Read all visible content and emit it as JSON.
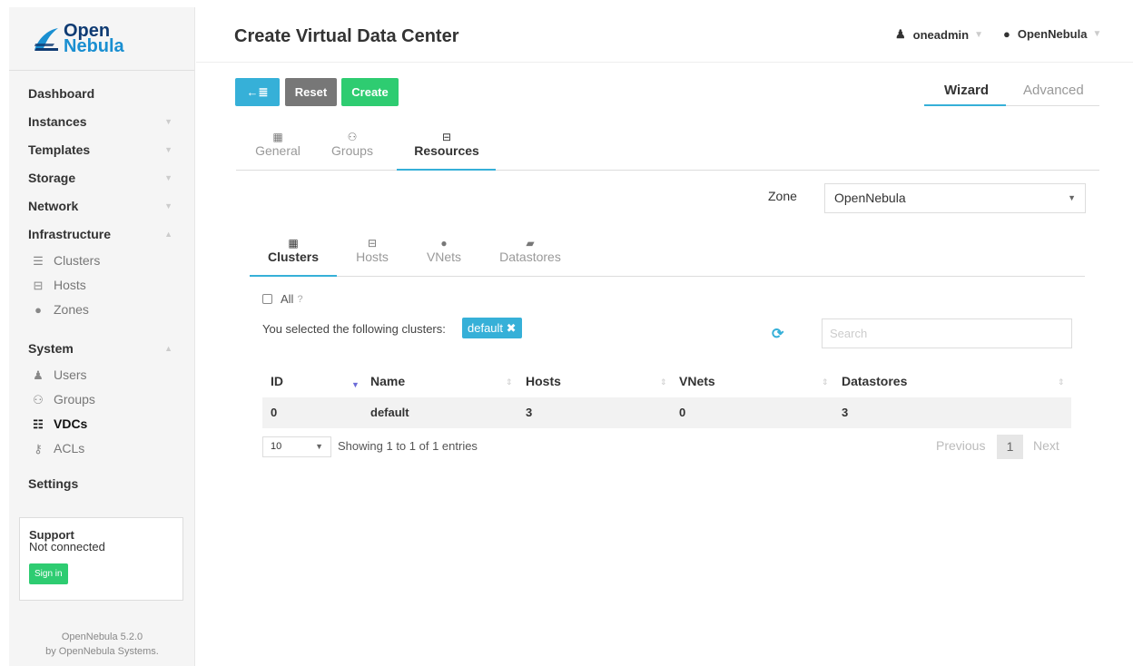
{
  "sidebar": {
    "logo": {
      "line1": "Open",
      "line2": "Nebula"
    },
    "menu": {
      "dashboard": "Dashboard",
      "instances": "Instances",
      "templates": "Templates",
      "storage": "Storage",
      "network": "Network",
      "infrastructure": "Infrastructure",
      "clusters": "Clusters",
      "hosts": "Hosts",
      "zones": "Zones",
      "system": "System",
      "users": "Users",
      "groups": "Groups",
      "vdcs": "VDCs",
      "acls": "ACLs",
      "settings": "Settings"
    },
    "support": {
      "title": "Support",
      "status": "Not connected",
      "signin": "Sign in"
    },
    "version": {
      "line1": "OpenNebula 5.2.0",
      "line2": "by OpenNebula Systems."
    }
  },
  "header": {
    "title": "Create Virtual Data Center",
    "user": "oneadmin",
    "zone": "OpenNebula"
  },
  "toolbar": {
    "back": "←≣",
    "reset": "Reset",
    "create": "Create",
    "wizard": "Wizard",
    "advanced": "Advanced"
  },
  "tabs": {
    "general": "General",
    "groups": "Groups",
    "resources": "Resources"
  },
  "zone": {
    "label": "Zone",
    "value": "OpenNebula"
  },
  "subtabs": {
    "clusters": "Clusters",
    "hosts": "Hosts",
    "vnets": "VNets",
    "datastores": "Datastores"
  },
  "selection": {
    "all": "All",
    "text": "You selected the following clusters:",
    "tag": "default ✖"
  },
  "search": {
    "placeholder": "Search"
  },
  "table": {
    "headers": [
      "ID",
      "Name",
      "Hosts",
      "VNets",
      "Datastores"
    ],
    "rows": [
      [
        "0",
        "default",
        "3",
        "0",
        "3"
      ]
    ]
  },
  "pagination": {
    "page_size": "10",
    "showing": "Showing 1 to 1 of 1 entries",
    "previous": "Previous",
    "current": "1",
    "next": "Next"
  },
  "colors": {
    "accent": "#36b0d8",
    "create": "#2ecc71",
    "reset": "#777777"
  }
}
